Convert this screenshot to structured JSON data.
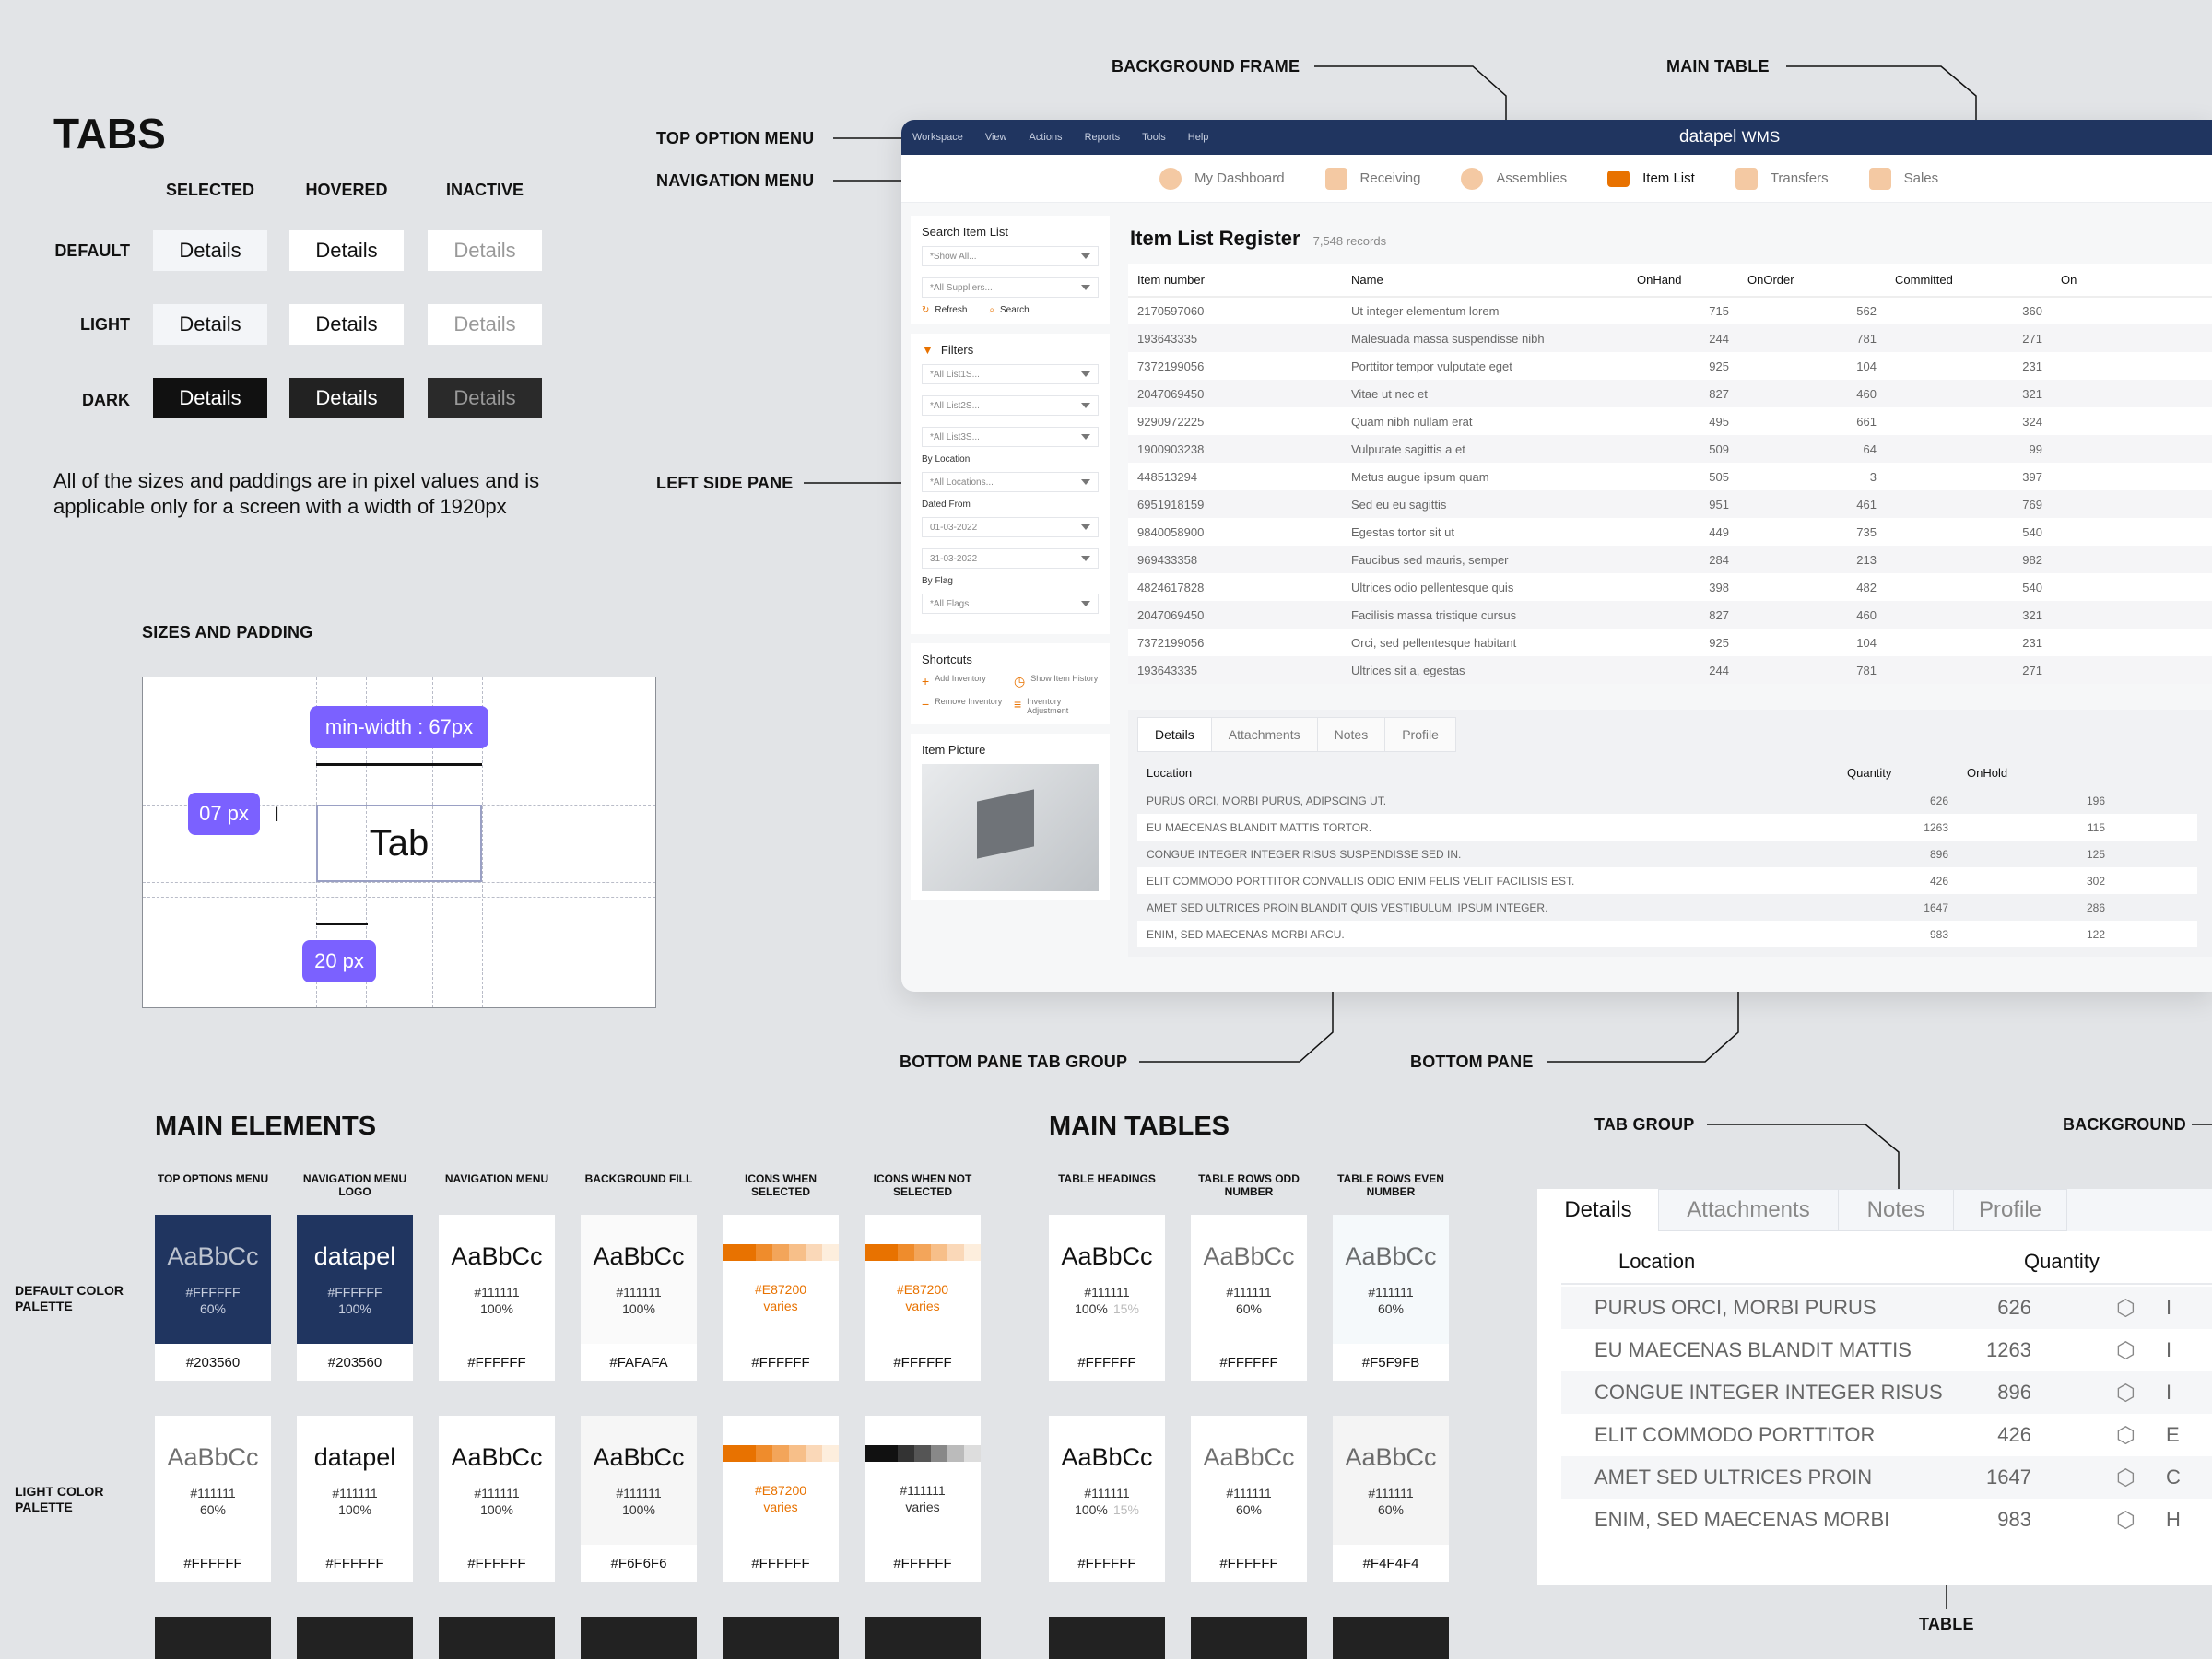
{
  "tabs_spec": {
    "title": "TABS",
    "columns": [
      "SELECTED",
      "HOVERED",
      "INACTIVE"
    ],
    "rows": [
      "DEFAULT",
      "LIGHT",
      "DARK"
    ],
    "tab_label": "Details",
    "note": "All of the sizes and paddings are in pixel values and is applicable only for a screen with a width of 1920px"
  },
  "sizes": {
    "title": "SIZES AND PADDING",
    "min_width": "min-width : 67px",
    "vertical_padding": "07 px",
    "horizontal_padding": "20 px",
    "sample": "Tab"
  },
  "callouts": {
    "background_frame": "BACKGROUND FRAME",
    "main_table": "MAIN TABLE",
    "top_option_menu": "TOP OPTION MENU",
    "navigation_menu": "NAVIGATION MENU",
    "left_side_pane": "LEFT SIDE PANE",
    "bottom_pane_tab_group": "BOTTOM PANE TAB GROUP",
    "bottom_pane": "BOTTOM PANE",
    "tab_group": "TAB GROUP",
    "background": "BACKGROUND",
    "table": "TABLE"
  },
  "app": {
    "top_menu": [
      "Workspace",
      "View",
      "Actions",
      "Reports",
      "Tools",
      "Help"
    ],
    "brand": "datapel",
    "brand_suffix": "WMS",
    "nav": [
      {
        "label": "My Dashboard",
        "selected": false
      },
      {
        "label": "Receiving",
        "selected": false
      },
      {
        "label": "Assemblies",
        "selected": false
      },
      {
        "label": "Item List",
        "selected": true
      },
      {
        "label": "Transfers",
        "selected": false
      },
      {
        "label": "Sales",
        "selected": false
      }
    ],
    "search": {
      "title": "Search Item List",
      "show_all": "*Show All...",
      "all_suppliers": "*All Suppliers...",
      "refresh": "Refresh",
      "search": "Search"
    },
    "filters": {
      "title": "Filters",
      "list1": "*All List1S...",
      "list2": "*All List2S...",
      "list3": "*All List3S...",
      "by_location": "By Location",
      "all_locations": "*All Locations...",
      "dated_from": "Dated From",
      "date_from": "01-03-2022",
      "date_to": "31-03-2022",
      "by_flag": "By Flag",
      "all_flags": "*All Flags"
    },
    "shortcuts": {
      "title": "Shortcuts",
      "add": "Add Inventory",
      "history": "Show Item History",
      "remove": "Remove Inventory",
      "adjust": "Inventory Adjustment"
    },
    "item_picture": "Item Picture",
    "register_title": "Item List Register",
    "record_count": "7,548 records",
    "table_headers": [
      "Item number",
      "Name",
      "OnHand",
      "OnOrder",
      "Committed",
      "On"
    ],
    "rows": [
      [
        "2170597060",
        "Ut integer elementum lorem",
        "715",
        "562",
        "360"
      ],
      [
        "193643335",
        "Malesuada massa suspendisse nibh",
        "244",
        "781",
        "271"
      ],
      [
        "7372199056",
        "Porttitor tempor vulputate eget",
        "925",
        "104",
        "231"
      ],
      [
        "2047069450",
        "Vitae ut nec et",
        "827",
        "460",
        "321"
      ],
      [
        "9290972225",
        "Quam nibh nullam erat",
        "495",
        "661",
        "324"
      ],
      [
        "1900903238",
        "Vulputate sagittis a et",
        "509",
        "64",
        "99"
      ],
      [
        "448513294",
        "Metus augue ipsum quam",
        "505",
        "3",
        "397"
      ],
      [
        "6951918159",
        "Sed eu eu sagittis",
        "951",
        "461",
        "769"
      ],
      [
        "9840058900",
        "Egestas tortor sit ut",
        "449",
        "735",
        "540"
      ],
      [
        "969433358",
        "Faucibus sed mauris, semper",
        "284",
        "213",
        "982"
      ],
      [
        "4824617828",
        "Ultrices odio pellentesque quis",
        "398",
        "482",
        "540"
      ],
      [
        "2047069450",
        "Facilisis massa tristique cursus",
        "827",
        "460",
        "321"
      ],
      [
        "7372199056",
        "Orci, sed pellentesque habitant",
        "925",
        "104",
        "231"
      ],
      [
        "193643335",
        "Ultrices sit a, egestas",
        "244",
        "781",
        "271"
      ]
    ],
    "bottom_tabs": [
      "Details",
      "Attachments",
      "Notes",
      "Profile"
    ],
    "bottom_headers": [
      "Location",
      "Quantity",
      "OnHold"
    ],
    "bottom_rows": [
      [
        "PURUS ORCI, MORBI PURUS, ADIPSCING UT.",
        "626",
        "196"
      ],
      [
        "EU MAECENAS BLANDIT MATTIS TORTOR.",
        "1263",
        "115"
      ],
      [
        "CONGUE INTEGER INTEGER RISUS SUSPENDISSE SED IN.",
        "896",
        "125"
      ],
      [
        "ELIT COMMODO PORTTITOR CONVALLIS ODIO ENIM FELIS VELIT FACILISIS EST.",
        "426",
        "302"
      ],
      [
        "AMET SED ULTRICES PROIN BLANDIT QUIS VESTIBULUM, IPSUM INTEGER.",
        "1647",
        "286"
      ],
      [
        "ENIM, SED MAECENAS MORBI ARCU.",
        "983",
        "122"
      ]
    ]
  },
  "main_elements": {
    "title": "MAIN ELEMENTS",
    "heads": [
      "TOP OPTIONS MENU",
      "NAVIGATION MENU LOGO",
      "NAVIGATION MENU",
      "BACKGROUND FILL",
      "ICONS WHEN SELECTED",
      "ICONS WHEN NOT SELECTED"
    ],
    "default_label": "DEFAULT COLOR PALETTE",
    "light_label": "LIGHT COLOR PALETTE",
    "sample": "AaBbCc",
    "logo": "datapel",
    "default": [
      {
        "c1": "#FFFFFF",
        "c2": "60%",
        "bg": "#203560",
        "big": "AaBbCc"
      },
      {
        "c1": "#FFFFFF",
        "c2": "100%",
        "bg": "#203560",
        "big": "datapel"
      },
      {
        "c1": "#111111",
        "c2": "100%",
        "bg": "#FFFFFF",
        "big": "AaBbCc"
      },
      {
        "c1": "#111111",
        "c2": "100%",
        "bg": "#FAFAFA",
        "big": "AaBbCc"
      },
      {
        "c1": "#E87200",
        "c2": "varies",
        "bg": "#FFFFFF",
        "big": ""
      },
      {
        "c1": "#E87200",
        "c2": "varies",
        "bg": "#FFFFFF",
        "big": ""
      }
    ],
    "light": [
      {
        "c1": "#111111",
        "c2": "60%",
        "bg": "#FFFFFF",
        "big": "AaBbCc"
      },
      {
        "c1": "#111111",
        "c2": "100%",
        "bg": "#FFFFFF",
        "big": "datapel"
      },
      {
        "c1": "#111111",
        "c2": "100%",
        "bg": "#FFFFFF",
        "big": "AaBbCc"
      },
      {
        "c1": "#111111",
        "c2": "100%",
        "bg": "#F6F6F6",
        "big": "AaBbCc"
      },
      {
        "c1": "#E87200",
        "c2": "varies",
        "bg": "#FFFFFF",
        "big": ""
      },
      {
        "c1": "#111111",
        "c2": "varies",
        "bg": "#FFFFFF",
        "big": ""
      }
    ]
  },
  "main_tables": {
    "title": "MAIN TABLES",
    "heads": [
      "TABLE HEADINGS",
      "TABLE ROWS ODD NUMBER",
      "TABLE ROWS EVEN NUMBER"
    ],
    "default": [
      {
        "c1": "#111111",
        "c2": "100%",
        "c3": "15%",
        "bg": "#FFFFFF"
      },
      {
        "c1": "#111111",
        "c2": "60%",
        "c3": "",
        "bg": "#FFFFFF"
      },
      {
        "c1": "#111111",
        "c2": "60%",
        "c3": "",
        "bg": "#F5F9FB"
      }
    ],
    "light": [
      {
        "c1": "#111111",
        "c2": "100%",
        "c3": "15%",
        "bg": "#FFFFFF"
      },
      {
        "c1": "#111111",
        "c2": "60%",
        "c3": "",
        "bg": "#FFFFFF"
      },
      {
        "c1": "#111111",
        "c2": "60%",
        "c3": "",
        "bg": "#F4F4F4"
      }
    ]
  },
  "tab_group_sample": {
    "tabs": [
      "Details",
      "Attachments",
      "Notes",
      "Profile"
    ],
    "headers": [
      "Location",
      "Quantity"
    ],
    "rows": [
      [
        "PURUS ORCI, MORBI PURUS",
        "626",
        "I"
      ],
      [
        "EU MAECENAS BLANDIT MATTIS",
        "1263",
        "I"
      ],
      [
        "CONGUE INTEGER INTEGER RISUS",
        "896",
        "I"
      ],
      [
        "ELIT COMMODO PORTTITOR",
        "426",
        "E"
      ],
      [
        "AMET SED ULTRICES PROIN",
        "1647",
        "C"
      ],
      [
        "ENIM, SED MAECENAS MORBI",
        "983",
        "H"
      ]
    ]
  },
  "colors": {
    "navy": "#203560",
    "accent": "#E87200",
    "purple": "#7B61FF"
  }
}
